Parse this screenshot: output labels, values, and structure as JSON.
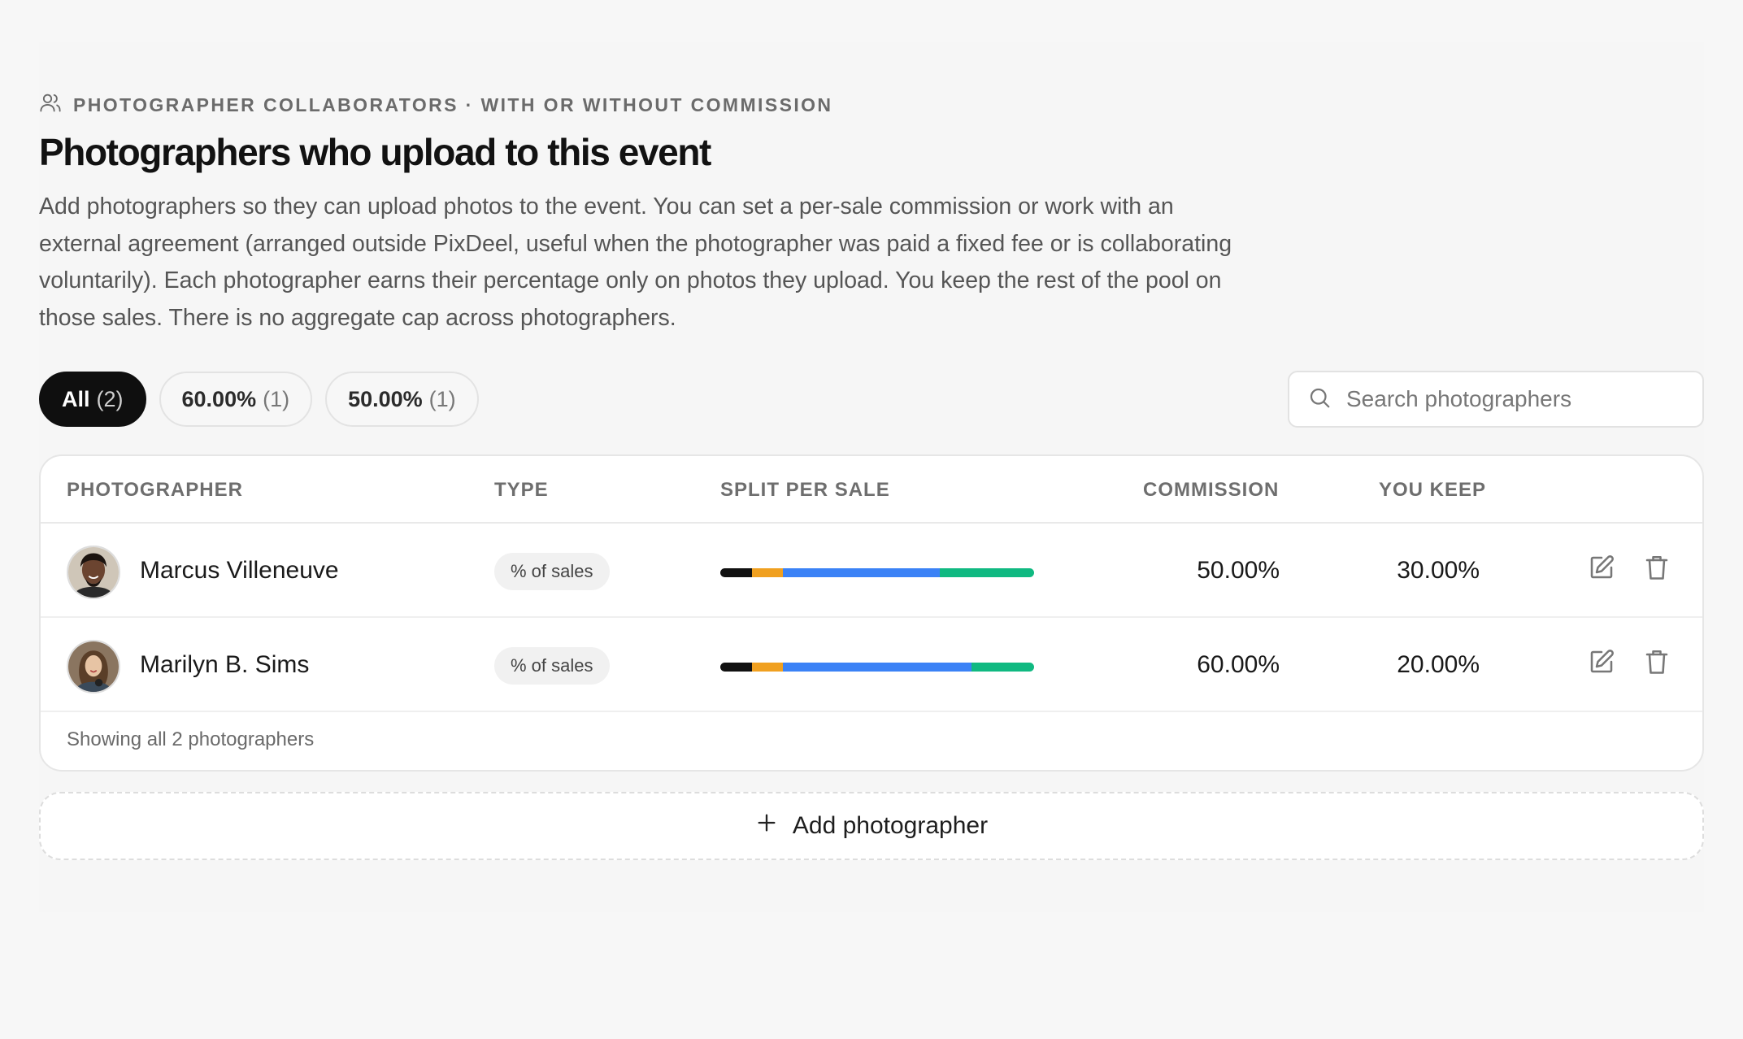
{
  "section": {
    "eyebrow": "PHOTOGRAPHER COLLABORATORS · WITH OR WITHOUT COMMISSION",
    "eyebrow_icon": "users-icon",
    "title": "Photographers who upload to this event",
    "description": "Add photographers so they can upload photos to the event. You can set a per-sale commission or work with an external agreement (arranged outside PixDeel, useful when the photographer was paid a fixed fee or is collaborating voluntarily). Each photographer earns their percentage only on photos they upload. You keep the rest of the pool on those sales. There is no aggregate cap across photographers."
  },
  "filters": [
    {
      "label": "All",
      "count": "(2)",
      "active": true
    },
    {
      "label": "60.00%",
      "count": "(1)",
      "active": false
    },
    {
      "label": "50.00%",
      "count": "(1)",
      "active": false
    }
  ],
  "search": {
    "placeholder": "Search photographers",
    "icon": "search-icon"
  },
  "table": {
    "headers": {
      "photographer": "PHOTOGRAPHER",
      "type": "TYPE",
      "split": "SPLIT PER SALE",
      "commission": "COMMISSION",
      "you_keep": "YOU KEEP"
    },
    "rows": [
      {
        "name": "Marcus Villeneuve",
        "type": "% of sales",
        "split_fractions": {
          "black": 0.1,
          "orange": 0.1,
          "blue": 0.5,
          "green": 0.3
        },
        "commission": "50.00%",
        "you_keep": "30.00%"
      },
      {
        "name": "Marilyn B. Sims",
        "type": "% of sales",
        "split_fractions": {
          "black": 0.1,
          "orange": 0.1,
          "blue": 0.6,
          "green": 0.2
        },
        "commission": "60.00%",
        "you_keep": "20.00%"
      }
    ],
    "footer": "Showing all 2 photographers"
  },
  "add_button": {
    "label": "Add photographer",
    "icon": "plus-icon"
  },
  "colors": {
    "split_black": "#111111",
    "split_orange": "#f0a020",
    "split_blue": "#3b82f6",
    "split_green": "#10b981",
    "chip_active_bg": "#0f0f0f"
  }
}
